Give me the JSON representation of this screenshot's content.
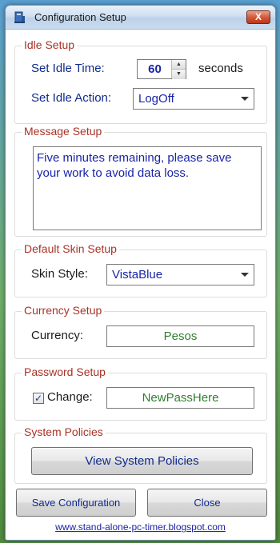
{
  "window": {
    "title": "Configuration Setup",
    "close_glyph": "X"
  },
  "idle": {
    "group_title": "Idle Setup",
    "time_label": "Set Idle Time:",
    "time_value": "60",
    "time_unit": "seconds",
    "action_label": "Set Idle Action:",
    "action_value": "LogOff"
  },
  "message": {
    "group_title": "Message Setup",
    "text": "Five minutes remaining, please save your work to avoid data loss."
  },
  "skin": {
    "group_title": "Default Skin Setup",
    "label": "Skin Style:",
    "value": "VistaBlue"
  },
  "currency": {
    "group_title": "Currency Setup",
    "label": "Currency:",
    "value": "Pesos"
  },
  "password": {
    "group_title": "Password Setup",
    "change_label": "Change:",
    "checked": true,
    "value": "NewPassHere"
  },
  "policies": {
    "group_title": "System Policies",
    "button_label": "View System Policies"
  },
  "footer": {
    "save_label": "Save Configuration",
    "close_label": "Close",
    "link_text": "www.stand-alone-pc-timer.blogspot.com"
  },
  "colors": {
    "group_title": "#a93226",
    "label_blue": "#102a8c",
    "value_blue": "#1a24a8",
    "value_green": "#2f7f2f"
  }
}
